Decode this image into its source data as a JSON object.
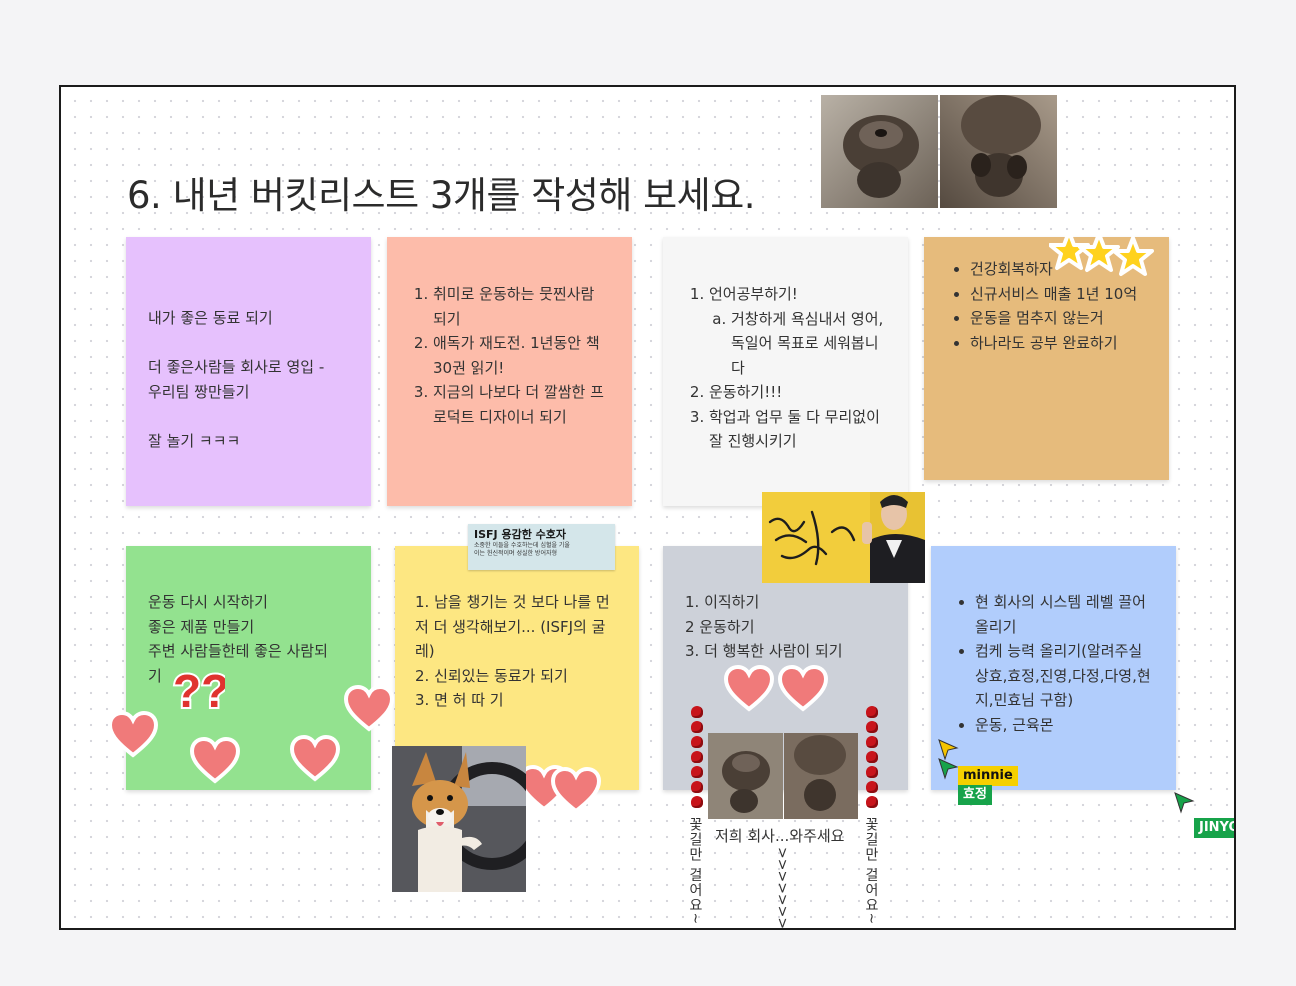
{
  "title": "6. 내년 버킷리스트 3개를 작성해 보세요.",
  "notes": {
    "purple": {
      "line1": "내가 좋은 동료 되기",
      "line2a": "더 좋은사람들 회사로 영입 -",
      "line2b": "우리팀 짱만들기",
      "line3": "잘 놀기 ㅋㅋㅋ",
      "color": "#e6c1fd"
    },
    "salmon": {
      "items": [
        "취미로 운동하는 뭇찐사람 되기",
        "애독가 재도전. 1년동안 책 30권 읽기!",
        "지금의 나보다 더 깔쌈한 프로덕트 디자이너 되기"
      ],
      "color": "#fdbcaa"
    },
    "white": {
      "item1": "언어공부하기!",
      "item1a": "거창하게 욕심내서 영어, 독일어 목표로 세워봅니다",
      "item2": "운동하기!!!",
      "item3": "학업과 업무 둘 다 무리없이 잘 진행시키기",
      "color": "#f6f6f6"
    },
    "orange": {
      "items": [
        "건강회복하자",
        "신규서비스 매출 1년 10억",
        "운동을 멈추지 않는거",
        "하나라도 공부 완료하기"
      ],
      "color": "#e6bb7c"
    },
    "green": {
      "line1": "운동 다시 시작하기",
      "line2": "좋은 제품 만들기",
      "line3": "주변 사람들한테 좋은 사람되",
      "line4": "기",
      "color": "#93e28f"
    },
    "yellow": {
      "line1": "1. 남을 챙기는 것 보다 나를 먼저 더 생각해보기... (ISFJ의 굴레)",
      "line2": "2. 신뢰있는 동료가 되기",
      "line3": "3. 면 허 따 기",
      "color": "#fde782"
    },
    "gray": {
      "line1": "1. 이직하기",
      "line2": "2 운동하기",
      "line3": "3. 더 행복한 사람이 되기",
      "color": "#cdd1d9"
    },
    "blue": {
      "items": [
        "현 회사의 시스템 레벨 끌어올리기",
        "컴케 능력 올리기(알려주실 상효,효정,진영,다정,다영,현지,민효님 구함)",
        "운동, 근육몬"
      ],
      "color": "#b1cdfc"
    }
  },
  "sticker_isfj": {
    "title": "ISFJ 용감한 수호자",
    "body1": "소중한 이들을 수호하는데 심혈을 기울",
    "body2": "이는 헌신적이며 성실한 방어자형"
  },
  "sticker_calligraphy": "더 너무 할수있어",
  "vertical_text": {
    "left": "꽃길만 걸어요~",
    "right": "꽃길만 걸어요~",
    "caption": "저희 회사...와주세요",
    "arrows": ">>>>>>>"
  },
  "cursors": {
    "minnie": {
      "label": "minnie",
      "color": "#f5d000"
    },
    "hyojeong": {
      "label": "효정",
      "color": "#17a34a"
    },
    "jiny": {
      "label": "JINYO",
      "color": "#17a34a"
    }
  },
  "colors": {
    "heart": "#f07a7a",
    "star": "#ffd21e"
  }
}
